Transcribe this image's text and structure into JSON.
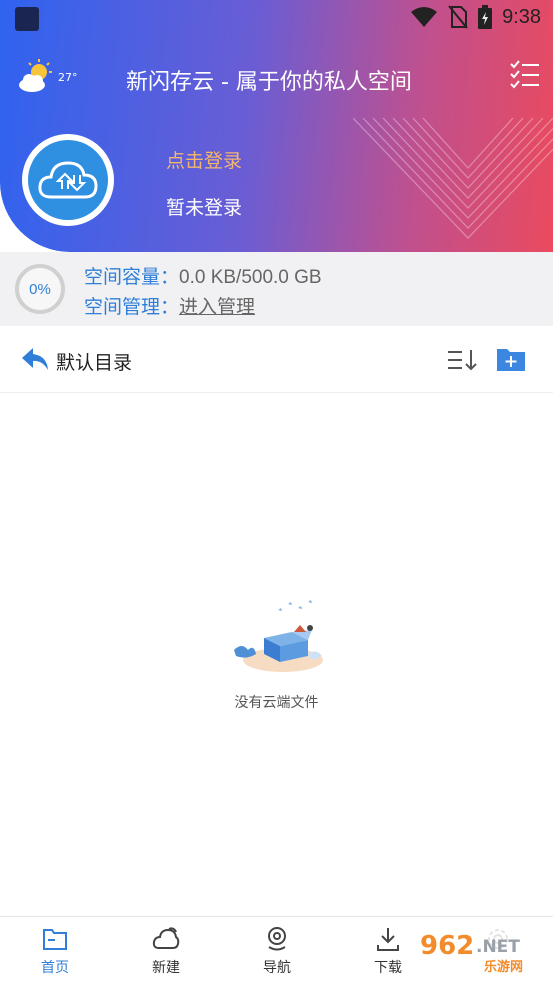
{
  "status_bar": {
    "time": "9:38"
  },
  "header": {
    "temperature": "27°",
    "title": "新闪存云 - 属于你的私人空间",
    "login_link": "点击登录",
    "login_status": "暂未登录"
  },
  "storage": {
    "percent": "0%",
    "percent_value": 0,
    "capacity_label": "空间容量：",
    "capacity_value": "0.0 KB/500.0 GB",
    "manage_label": "空间管理：",
    "manage_link": "进入管理"
  },
  "directory": {
    "title": "默认目录"
  },
  "empty_state": {
    "text": "没有云端文件"
  },
  "tabs": [
    {
      "label": "首页",
      "icon": "folder-icon",
      "active": true
    },
    {
      "label": "新建",
      "icon": "cloud-icon",
      "active": false
    },
    {
      "label": "导航",
      "icon": "location-icon",
      "active": false
    },
    {
      "label": "下载",
      "icon": "download-icon",
      "active": false
    },
    {
      "label": "",
      "icon": "settings-icon",
      "active": false
    }
  ],
  "watermark": {
    "text": "962.NET",
    "subtext": "乐游网"
  },
  "colors": {
    "accent": "#2f7fd8",
    "header_start": "#2f63ef",
    "header_end": "#ea4a5e",
    "login_link": "#f5b66f"
  }
}
